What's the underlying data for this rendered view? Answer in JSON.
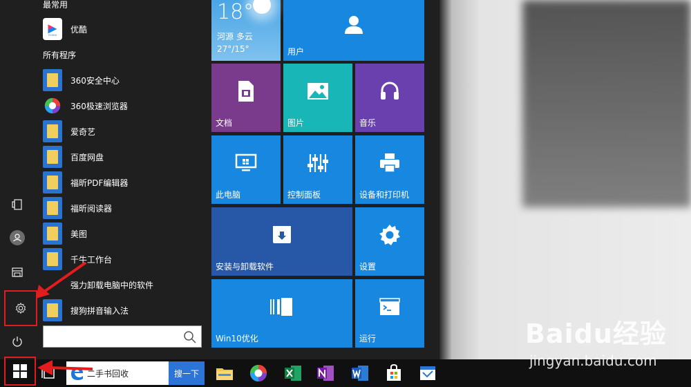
{
  "sections": {
    "recent": "最常用",
    "all_programs": "所有程序"
  },
  "recent_apps": [
    {
      "label": "优酷",
      "icon": "youku-icon"
    }
  ],
  "apps": [
    {
      "label": "360安全中心",
      "icon": "folder-icon"
    },
    {
      "label": "360极速浏览器",
      "icon": "360-browser-icon"
    },
    {
      "label": "爱奇艺",
      "icon": "folder-icon"
    },
    {
      "label": "百度网盘",
      "icon": "folder-icon"
    },
    {
      "label": "福昕PDF编辑器",
      "icon": "folder-icon"
    },
    {
      "label": "福昕阅读器",
      "icon": "folder-icon"
    },
    {
      "label": "美图",
      "icon": "folder-icon"
    },
    {
      "label": "千牛工作台",
      "icon": "folder-icon"
    },
    {
      "label": "强力卸载电脑中的软件",
      "icon": "uninstaller-icon"
    },
    {
      "label": "搜狗拼音输入法",
      "icon": "folder-icon"
    }
  ],
  "weather": {
    "temp": "18°",
    "city": "河源  多云",
    "range": "27°/15°"
  },
  "tiles": {
    "user": "用户",
    "documents": "文档",
    "pictures": "图片",
    "music": "音乐",
    "this_pc": "此电脑",
    "control_panel": "控制面板",
    "devices_printers": "设备和打印机",
    "install_uninstall": "安装与卸载软件",
    "settings": "设置",
    "win10_optimize": "Win10优化",
    "run": "运行"
  },
  "taskbar": {
    "search_text": "二手书回收",
    "search_button": "搜一下"
  },
  "watermark": {
    "logo": "Baidu经验",
    "url": "jingyan.baidu.com"
  },
  "colors": {
    "tile_blue": "#1787e0",
    "tile_purple": "#7a3b8c",
    "tile_teal": "#18b6b6",
    "tile_violet": "#6a3fae",
    "tile_navy": "#2758a8",
    "highlight_red": "#e11d1d",
    "search_button": "#2d74d7"
  }
}
